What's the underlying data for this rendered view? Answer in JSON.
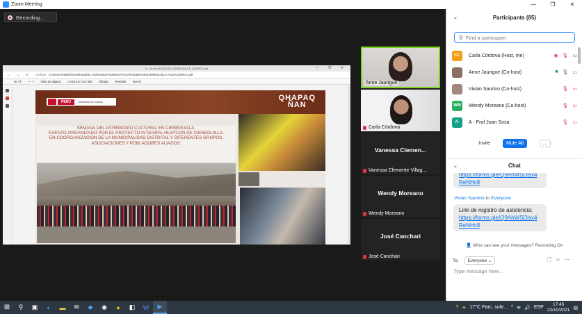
{
  "window": {
    "title": "Zoom Meeting"
  },
  "recording": {
    "label": "Recording..."
  },
  "browser": {
    "tab_title": "11. 2k HUAYCAN DE CIENEGUILLA. ACERCA.pdf",
    "url_prefix": "Archivo",
    "url": "C:/Users/ANNE/Downloads/11.%20%20ZA%20HUAYCAN%20DE%20CIENEGUILLA.%20ACERCA.pdf",
    "page_indicator": "de 74",
    "toolbar": [
      "Vista de página",
      "Lectura en voz alta",
      "Dibujar",
      "Resaltar",
      "Borrar"
    ]
  },
  "slide": {
    "country": "PERÚ",
    "ministry": "Ministerio de Cultura",
    "logo_line1": "QHAPAQ",
    "logo_line2": "ÑAN",
    "caption_lines": [
      "SEMANA DEL PATRIMONIO CULTURAL EN CIENEGUILLA.",
      "EVENTO ORGANIZADO POR EL PROYECTO INTEGRAL HUAYCAN DE CIENEGUILLA.",
      "EN COORGANIZACIÓN DE LA MUNICIPALIDAD DISTRITAL Y DIFERENTES GRUPOS, ASOCIACIONES Y POBLADORES ALIADOS."
    ]
  },
  "videos": [
    {
      "name": "Anne Jaurigue",
      "big": ""
    },
    {
      "name": "Carla Córdova",
      "big": ""
    },
    {
      "name": "Vanessa Clemente Villag...",
      "big": "Vanessa  Clemen..."
    },
    {
      "name": "Wendy Moreano",
      "big": "Wendy Moreano"
    },
    {
      "name": "José Canchari",
      "big": "José Canchari"
    }
  ],
  "participants": {
    "title": "Participants (85)",
    "search_placeholder": "Find a participant",
    "list": [
      {
        "initials": "CC",
        "name": "Carla Córdova (Host, me)",
        "color": "#f39c12"
      },
      {
        "initials": "",
        "name": "Anne Jaurigue (Co-host)",
        "color": "#8d6e63"
      },
      {
        "initials": "",
        "name": "Vivian Saurino (Co-host)",
        "color": "#a1887f"
      },
      {
        "initials": "WM",
        "name": "Wendy Moreano (Co-host)",
        "color": "#27ae60"
      },
      {
        "initials": "A-",
        "name": "A - Prof Juan Sosa",
        "color": "#16a085"
      }
    ],
    "invite": "Invite",
    "mute_all": "Mute All",
    "more": "..."
  },
  "chat": {
    "title": "Chat",
    "msg1_link": "https://forms.gle/Q9AhWSDisx4ReNHc8",
    "msg2_sender": "Vivian Saurino",
    "msg2_to": "to",
    "msg2_target": "Everyone",
    "msg2_text": "Link de registro de asistencia:",
    "msg2_link": "https://forms.gle/Q9AhWSDisx4ReNHc8",
    "who_can_see": "Who can see your messages? Recording On",
    "to_label": "To:",
    "to_value": "Everyone",
    "input_placeholder": "Type message here..."
  },
  "taskbar": {
    "weather": "17°C  Parc. sole...",
    "lang": "ESP",
    "time": "17:45",
    "date": "22/10/2021"
  }
}
